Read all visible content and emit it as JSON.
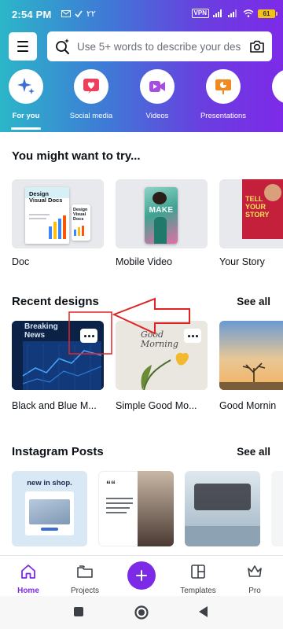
{
  "status": {
    "time": "2:54 PM",
    "extra": "٢٢",
    "vpn": "VPN",
    "battery": "61"
  },
  "search": {
    "placeholder": "Use 5+ words to describe your des"
  },
  "categories": [
    {
      "label": "For you",
      "icon": "sparkle-icon",
      "color": "#3b6fd6"
    },
    {
      "label": "Social media",
      "icon": "heart-icon",
      "color": "#ef3e5c"
    },
    {
      "label": "Videos",
      "icon": "video-icon",
      "color": "#a64ee0"
    },
    {
      "label": "Presentations",
      "icon": "presentation-icon",
      "color": "#f2891f"
    },
    {
      "label": "P",
      "icon": "print-icon",
      "color": "#9b4de6"
    }
  ],
  "try_section": {
    "title": "You might want to try...",
    "items": [
      {
        "label": "Doc",
        "thumb_title": "Design Visual Docs",
        "thumb_small": "Design Visual Docs"
      },
      {
        "label": "Mobile Video",
        "thumb_title": "MAKE"
      },
      {
        "label": "Your Story",
        "thumb_title": "TELL YOUR STORY"
      }
    ]
  },
  "recent_section": {
    "title": "Recent designs",
    "see_all": "See all",
    "items": [
      {
        "label": "Black and Blue M...",
        "thumb_text": "Breaking News"
      },
      {
        "label": "Simple Good Mo...",
        "thumb_text": "Good Morning"
      },
      {
        "label": "Good Mornin"
      }
    ]
  },
  "instagram_section": {
    "title": "Instagram Posts",
    "see_all": "See all",
    "items": [
      {
        "thumb_text": "new in shop."
      },
      {
        "thumb_text": "““"
      },
      {
        "thumb_text": ""
      },
      {
        "thumb_text": ""
      }
    ]
  },
  "bottom_nav": {
    "home": "Home",
    "projects": "Projects",
    "templates": "Templates",
    "pro": "Pro"
  },
  "colors": {
    "accent": "#7d2ae8",
    "annotation": "#e02424"
  }
}
